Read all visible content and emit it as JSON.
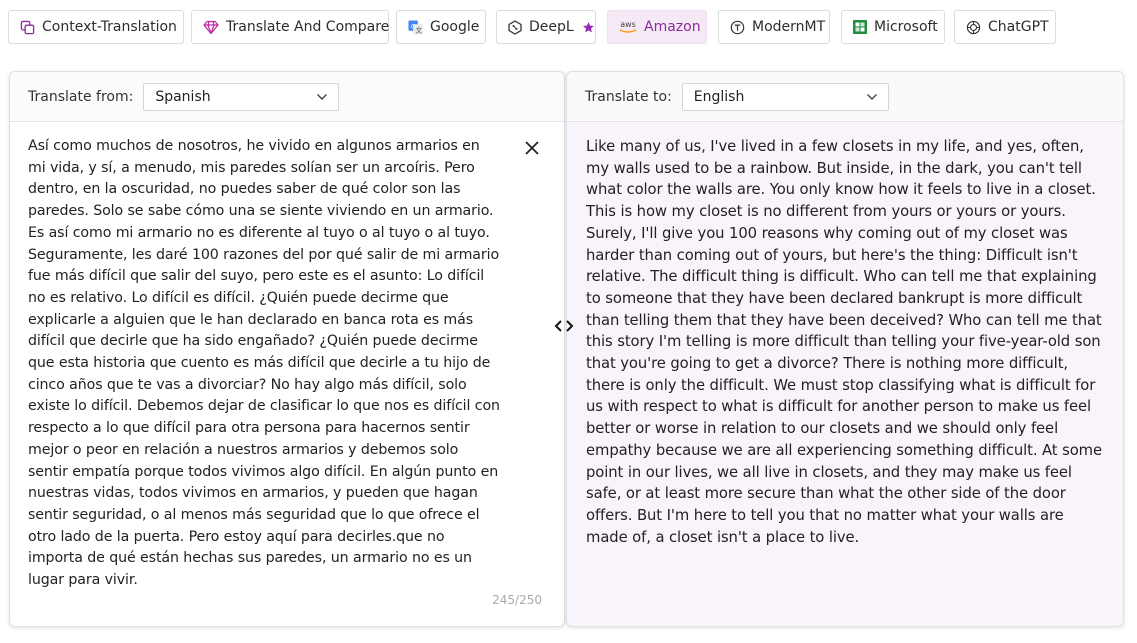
{
  "tabs": [
    {
      "label": "Context-Translation",
      "icon": "copy-icon"
    },
    {
      "label": "Translate And Compare",
      "icon": "diamond-icon"
    },
    {
      "label": "Google",
      "icon": "google-translate-icon"
    },
    {
      "label": "DeepL",
      "icon": "deepl-icon"
    },
    {
      "label": "Amazon",
      "icon": "aws-icon",
      "active": true
    },
    {
      "label": "ModernMT",
      "icon": "modernmt-icon"
    },
    {
      "label": "Microsoft",
      "icon": "microsoft-icon"
    },
    {
      "label": "ChatGPT",
      "icon": "chatgpt-icon"
    }
  ],
  "aws_icon_text": "aws",
  "accent": "#8a2d9b",
  "source": {
    "label": "Translate from:",
    "language": "Spanish",
    "text": "Así como muchos de nosotros, he vivido en algunos armarios en mi vida, y sí, a menudo, mis paredes solían ser un arcoíris. Pero dentro, en la oscuridad, no puedes saber de qué color son las paredes. Solo se sabe cómo una se siente viviendo en un armario. Es así como mi armario no es diferente al tuyo o al tuyo o al tuyo. Seguramente, les daré 100 razones del por qué salir de mi armario fue más difícil que salir del suyo, pero este es el asunto: Lo difícil no es relativo. Lo difícil es difícil. ¿Quién puede decirme que explicarle a alguien que le han declarado en banca rota es más difícil que decirle que ha sido engañado? ¿Quién puede decirme que esta historia que cuento es más difícil que decirle a tu hijo de cinco años que te vas a divorciar? No hay algo más difícil, solo existe lo difícil. Debemos dejar de clasificar lo que nos es difícil con respecto a lo que difícil para otra persona para hacernos sentir mejor o peor en relación a nuestros armarios y debemos solo sentir empatía porque todos vivimos algo difícil. En algún punto en nuestras vidas, todos vivimos en armarios, y pueden que hagan sentir seguridad, o al menos más seguridad que lo que ofrece el otro lado de la puerta. Pero estoy aquí para decirles.que no importa de qué están hechas sus paredes, un armario no es un lugar para vivir.",
    "counter": "245/250"
  },
  "target": {
    "label": "Translate to:",
    "language": "English",
    "text": "Like many of us, I've lived in a few closets in my life, and yes, often, my walls used to be a rainbow. But inside, in the dark, you can't tell what color the walls are. You only know how it feels to live in a closet. This is how my closet is no different from yours or yours or yours. Surely, I'll give you 100 reasons why coming out of my closet was harder than coming out of yours, but here's the thing: Difficult isn't relative. The difficult thing is difficult. Who can tell me that explaining to someone that they have been declared bankrupt is more difficult than telling them that they have been deceived? Who can tell me that this story I'm telling is more difficult than telling your five-year-old son that you're going to get a divorce? There is nothing more difficult, there is only the difficult. We must stop classifying what is difficult for us with respect to what is difficult for another person to make us feel better or worse in relation to our closets and we should only feel empathy because we are all experiencing something difficult. At some point in our lives, we all live in closets, and they may make us feel safe, or at least more secure than what the other side of the door offers. But I'm here to tell you that no matter what your walls are made of, a closet isn't a place to live."
  }
}
